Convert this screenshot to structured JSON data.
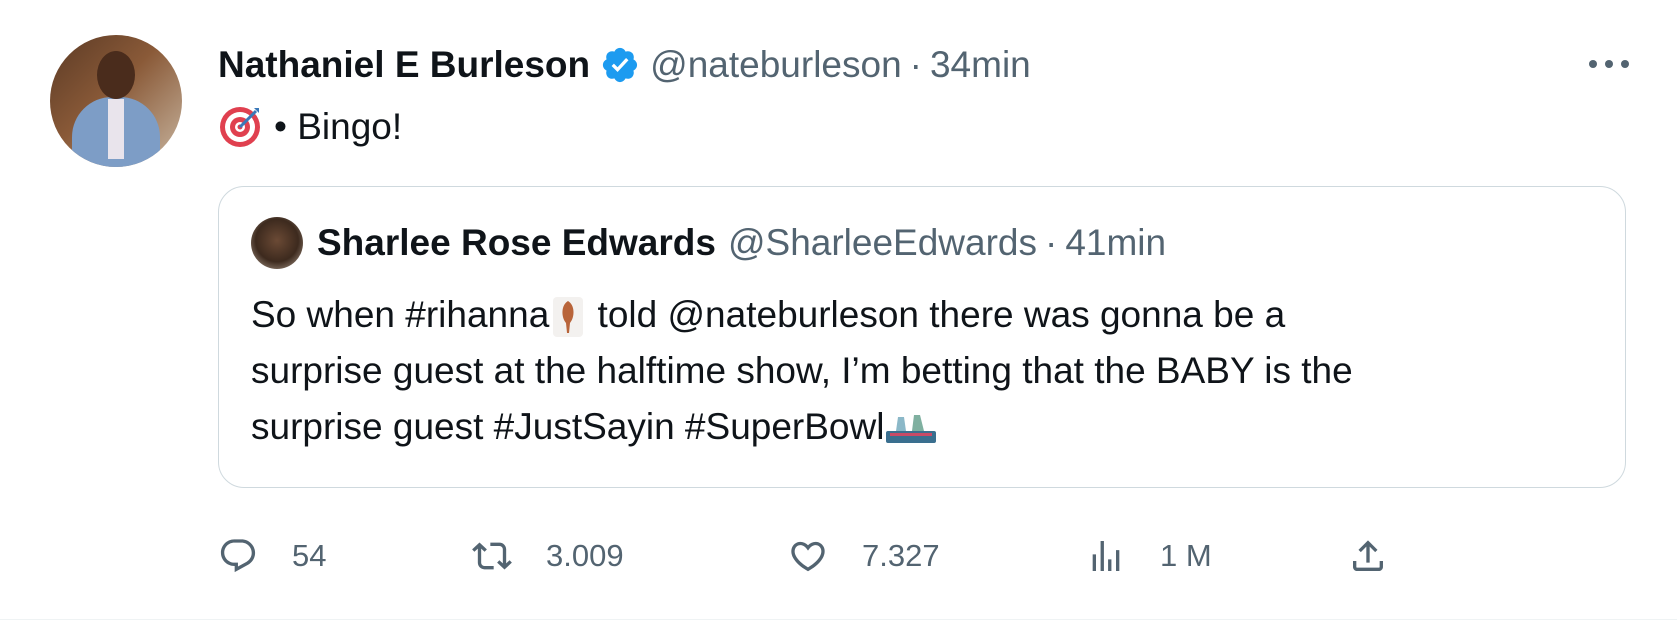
{
  "tweet": {
    "author_name": "Nathaniel E Burleson",
    "author_handle": "@nateburleson",
    "separator": "·",
    "time": "34min",
    "text": "• Bingo!",
    "text_emoji": "direct-hit-target-emoji"
  },
  "quote": {
    "author_name": "Sharlee Rose Edwards",
    "author_handle": "@SharleeEdwards",
    "separator": "·",
    "time": "41min",
    "line1_before": "So when #rihanna",
    "line1_after": " told @nateburleson there was gonna be a",
    "line2": "surprise guest at the halftime show, I’m betting that the BABY is the",
    "line3": "surprise guest #JustSayin #SuperBowl",
    "emoji_1": "rihanna-hashtag-emoji",
    "emoji_2": "superbowl-hashtag-emoji"
  },
  "actions": {
    "replies": "54",
    "retweets": "3.009",
    "likes": "7.327",
    "views": "1 M"
  },
  "colors": {
    "verified": "#1d9bf0",
    "secondary_text": "#536471",
    "border": "#cfd9de"
  },
  "icons": {
    "more": "more-horizontal-icon",
    "reply": "reply-icon",
    "retweet": "retweet-icon",
    "like": "heart-icon",
    "views": "views-bar-chart-icon",
    "share": "share-icon",
    "verified": "verified-badge-icon"
  }
}
